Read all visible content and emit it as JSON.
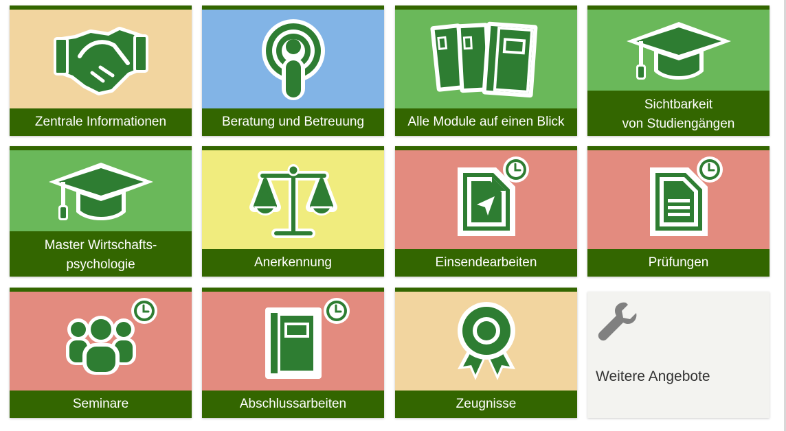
{
  "colors": {
    "dark_green": "#336600",
    "icon_green": "#2e7d32",
    "peach": "#f2d59f",
    "blue": "#82b4e6",
    "green": "#6ab85a",
    "yellow": "#f0ec7e",
    "salmon": "#e38b7f",
    "plain": "#f3f3f0"
  },
  "tiles": [
    {
      "label": "Zentrale Informationen",
      "icon": "handshake-icon",
      "color": "peach",
      "pending": false
    },
    {
      "label": "Beratung und Betreuung",
      "icon": "podcast-icon",
      "color": "blue",
      "pending": false
    },
    {
      "label": "Alle Module auf einen Blick",
      "icon": "modules-icon",
      "color": "green",
      "pending": false
    },
    {
      "label": "Sichtbarkeit\nvon Studiengängen",
      "icon": "graduation-cap-icon",
      "color": "green",
      "pending": false
    },
    {
      "label": "Master Wirtschafts-\npsychologie",
      "icon": "graduation-cap-icon",
      "color": "green",
      "pending": false
    },
    {
      "label": "Anerkennung",
      "icon": "scales-icon",
      "color": "yellow",
      "pending": false
    },
    {
      "label": "Einsendearbeiten",
      "icon": "document-send-icon",
      "color": "salmon",
      "pending": true
    },
    {
      "label": "Prüfungen",
      "icon": "document-icon",
      "color": "salmon",
      "pending": true
    },
    {
      "label": "Seminare",
      "icon": "group-icon",
      "color": "salmon",
      "pending": true
    },
    {
      "label": "Abschlussarbeiten",
      "icon": "notebook-icon",
      "color": "salmon",
      "pending": true
    },
    {
      "label": "Zeugnisse",
      "icon": "award-icon",
      "color": "peach",
      "pending": false
    }
  ],
  "extra": {
    "label": "Weitere Angebote",
    "icon": "wrench-icon"
  }
}
